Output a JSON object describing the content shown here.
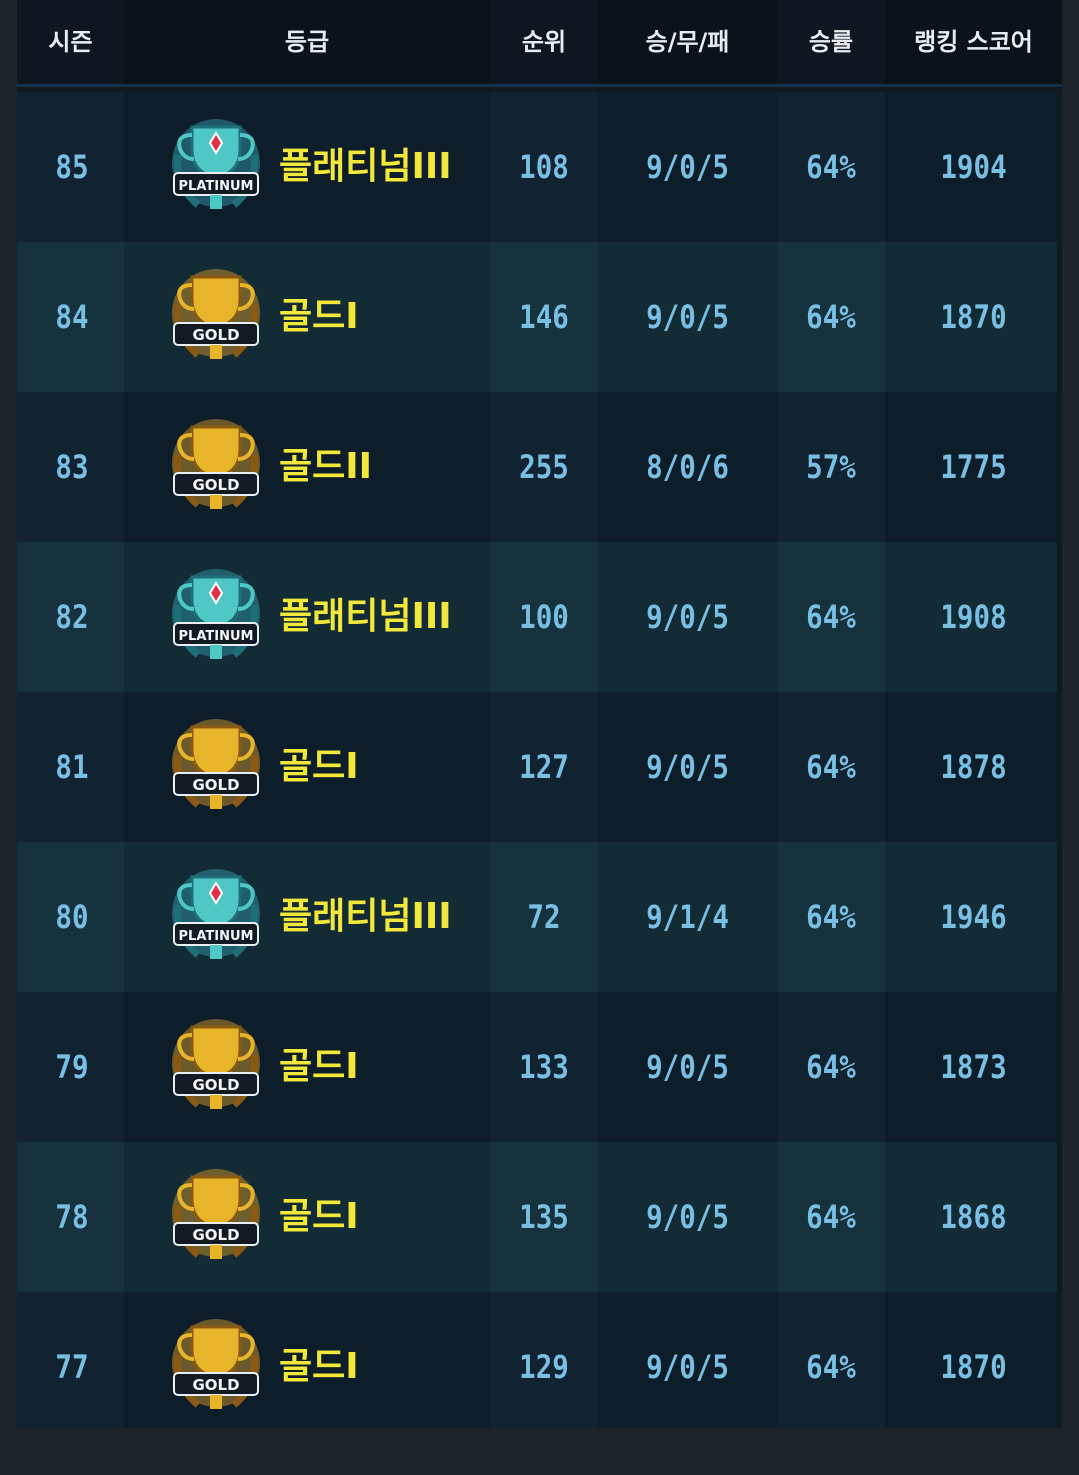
{
  "colors": {
    "background": "#1c2329",
    "header_text": "#e9edf1",
    "value_text": "#79bfe4",
    "grade_text": "#f2e83a",
    "row_dark": "#112230",
    "row_light": "#16323d"
  },
  "table": {
    "headers": {
      "season": "시즌",
      "grade": "등급",
      "rank": "순위",
      "record": "승/무/패",
      "win_rate": "승률",
      "score": "랭킹 스코어"
    },
    "rows": [
      {
        "season": "85",
        "grade": "플래티넘III",
        "emblem": "platinum-trophy-icon",
        "emblem_label": "PLATINUM",
        "rank": "108",
        "record": "9/0/5",
        "win_rate": "64%",
        "score": "1904"
      },
      {
        "season": "84",
        "grade": "골드I",
        "emblem": "gold-trophy-icon",
        "emblem_label": "GOLD",
        "rank": "146",
        "record": "9/0/5",
        "win_rate": "64%",
        "score": "1870"
      },
      {
        "season": "83",
        "grade": "골드II",
        "emblem": "gold-trophy-icon",
        "emblem_label": "GOLD",
        "rank": "255",
        "record": "8/0/6",
        "win_rate": "57%",
        "score": "1775"
      },
      {
        "season": "82",
        "grade": "플래티넘III",
        "emblem": "platinum-trophy-icon",
        "emblem_label": "PLATINUM",
        "rank": "100",
        "record": "9/0/5",
        "win_rate": "64%",
        "score": "1908"
      },
      {
        "season": "81",
        "grade": "골드I",
        "emblem": "gold-trophy-icon",
        "emblem_label": "GOLD",
        "rank": "127",
        "record": "9/0/5",
        "win_rate": "64%",
        "score": "1878"
      },
      {
        "season": "80",
        "grade": "플래티넘III",
        "emblem": "platinum-trophy-icon",
        "emblem_label": "PLATINUM",
        "rank": "72",
        "record": "9/1/4",
        "win_rate": "64%",
        "score": "1946"
      },
      {
        "season": "79",
        "grade": "골드I",
        "emblem": "gold-trophy-icon",
        "emblem_label": "GOLD",
        "rank": "133",
        "record": "9/0/5",
        "win_rate": "64%",
        "score": "1873"
      },
      {
        "season": "78",
        "grade": "골드I",
        "emblem": "gold-trophy-icon",
        "emblem_label": "GOLD",
        "rank": "135",
        "record": "9/0/5",
        "win_rate": "64%",
        "score": "1868"
      },
      {
        "season": "77",
        "grade": "골드I",
        "emblem": "gold-trophy-icon",
        "emblem_label": "GOLD",
        "rank": "129",
        "record": "9/0/5",
        "win_rate": "64%",
        "score": "1870"
      }
    ]
  }
}
